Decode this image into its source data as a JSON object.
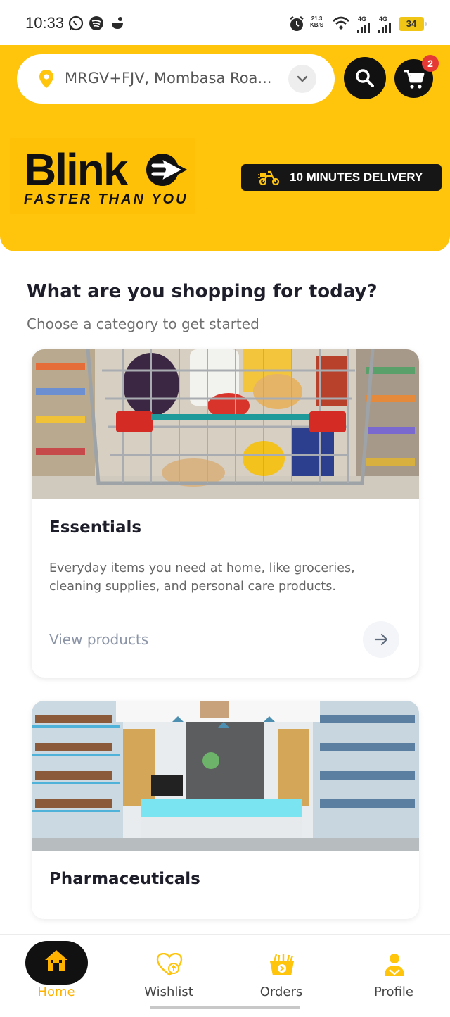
{
  "status_bar": {
    "time": "10:33",
    "net_speed_value": "21.3",
    "net_speed_unit": "KB/S",
    "signal_1": "4G",
    "signal_2": "4G",
    "battery": "34",
    "icons": [
      "whatsapp-icon",
      "spotify-icon",
      "cloud-icon",
      "alarm-icon",
      "wifi-icon",
      "signal-icon",
      "battery-icon"
    ]
  },
  "header": {
    "location": "MRGV+FJV, Mombasa Roa...",
    "cart_count": "2",
    "logo_word": "Blink",
    "logo_tagline": "FASTER THAN YOU",
    "delivery_badge": "10 MINUTES DELIVERY",
    "accent_color": "#ffc40c"
  },
  "main": {
    "heading": "What are you shopping for today?",
    "subheading": "Choose a category to get started",
    "categories": [
      {
        "title": "Essentials",
        "description": "Everyday items you need at home, like groceries, cleaning supplies, and personal care products.",
        "link": "View products"
      },
      {
        "title": "Pharmaceuticals"
      }
    ]
  },
  "bottom_nav": {
    "items": [
      {
        "label": "Home",
        "icon": "home-icon"
      },
      {
        "label": "Wishlist",
        "icon": "heart-icon"
      },
      {
        "label": "Orders",
        "icon": "basket-icon"
      },
      {
        "label": "Profile",
        "icon": "user-icon"
      }
    ],
    "active_color": "#ffb300"
  }
}
